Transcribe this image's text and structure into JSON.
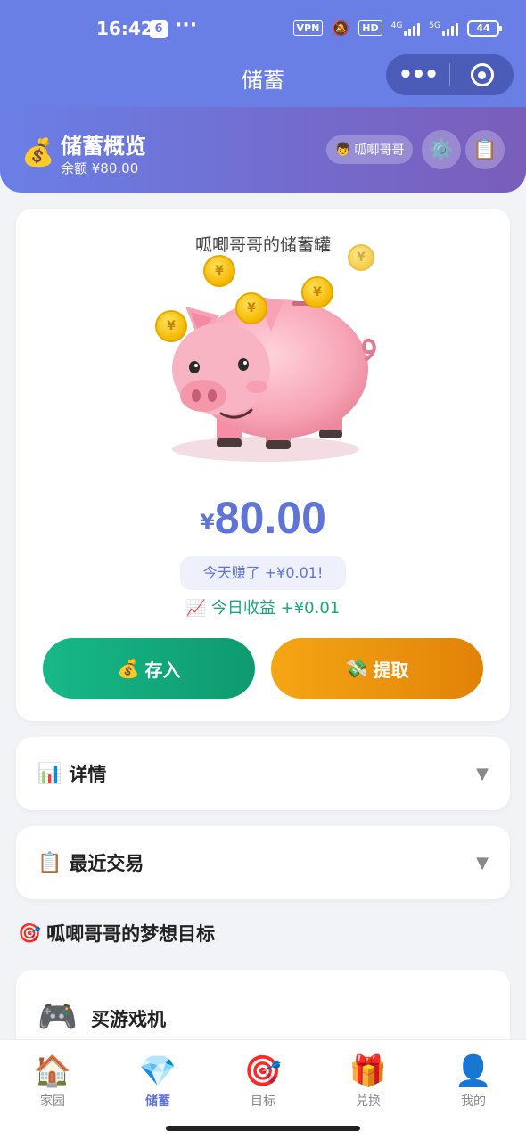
{
  "status_bar": {
    "time": "16:42",
    "more": "···",
    "vpn": "VPN",
    "hd": "HD",
    "net1": "4G",
    "net2": "5G",
    "battery": "44"
  },
  "nav": {
    "title": "储蓄",
    "more": "•••"
  },
  "overview": {
    "title": "储蓄概览",
    "balance": "余额 ¥80.00",
    "user": "呱唧哥哥"
  },
  "jar": {
    "title": "呱唧哥哥的储蓄罐",
    "yen": "¥",
    "amount": "80.00",
    "earned_today": "今天赚了 +¥0.01!",
    "today_income": "今日收益 +¥0.01",
    "deposit_label": "存入",
    "withdraw_label": "提取"
  },
  "sections": {
    "details": "详情",
    "transactions": "最近交易"
  },
  "goals": {
    "title": "呱唧哥哥的梦想目标",
    "items": [
      {
        "name": "买游戏机"
      }
    ]
  },
  "tabs": [
    {
      "label": "家园",
      "icon": "🏠"
    },
    {
      "label": "储蓄",
      "icon": "💎"
    },
    {
      "label": "目标",
      "icon": "🎯"
    },
    {
      "label": "兑换",
      "icon": "🎁"
    },
    {
      "label": "我的",
      "icon": "👤"
    }
  ],
  "colors": {
    "primary": "#6a7fe6",
    "accent_text": "#5f74d9",
    "deposit": "#17b887",
    "withdraw": "#f5a614",
    "income": "#1aa776"
  }
}
